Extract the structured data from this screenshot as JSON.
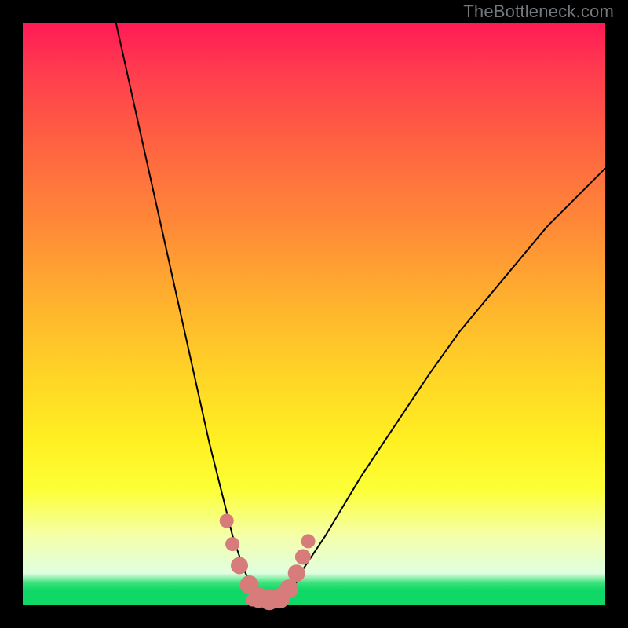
{
  "watermark": "TheBottleneck.com",
  "colors": {
    "frame_border": "#000000",
    "gradient_top": "#ff1a55",
    "gradient_mid": "#fff022",
    "gradient_bottom_band": "#0fd866",
    "curve": "#000000",
    "markers": "#d77b7b"
  },
  "chart_data": {
    "type": "line",
    "title": "",
    "xlabel": "",
    "ylabel": "",
    "xlim": [
      0,
      100
    ],
    "ylim": [
      0,
      100
    ],
    "grid": false,
    "legend": false,
    "series": [
      {
        "name": "bottleneck-curve",
        "x": [
          16,
          18,
          20,
          22,
          24,
          26,
          28,
          30,
          32,
          34,
          35,
          36,
          37,
          38,
          39,
          40,
          41,
          42,
          43,
          44,
          45,
          46,
          47,
          48,
          50,
          52,
          55,
          58,
          62,
          66,
          70,
          75,
          80,
          85,
          90,
          95,
          100
        ],
        "y": [
          100,
          91,
          82,
          73,
          64,
          55,
          46,
          37,
          28,
          20,
          16,
          12,
          9,
          6,
          4,
          2,
          1,
          1,
          1,
          1,
          1,
          2,
          4,
          6,
          9,
          12,
          17,
          22,
          28,
          34,
          40,
          47,
          53,
          59,
          65,
          70,
          75
        ]
      }
    ],
    "markers": {
      "name": "highlighted-points",
      "x": [
        35.0,
        36.0,
        37.2,
        38.9,
        40.5,
        42.3,
        44.1,
        45.7,
        47.0,
        48.1,
        49.0
      ],
      "y": [
        14.5,
        10.5,
        6.8,
        3.5,
        1.3,
        0.9,
        1.2,
        2.8,
        5.5,
        8.3,
        11.0
      ],
      "radius": [
        9,
        9,
        11,
        12,
        13,
        13,
        13,
        12,
        11,
        10,
        9
      ]
    },
    "valley_bar": {
      "x_start": 38.3,
      "x_end": 45.7,
      "y": 0.9,
      "height": 2.2
    }
  }
}
